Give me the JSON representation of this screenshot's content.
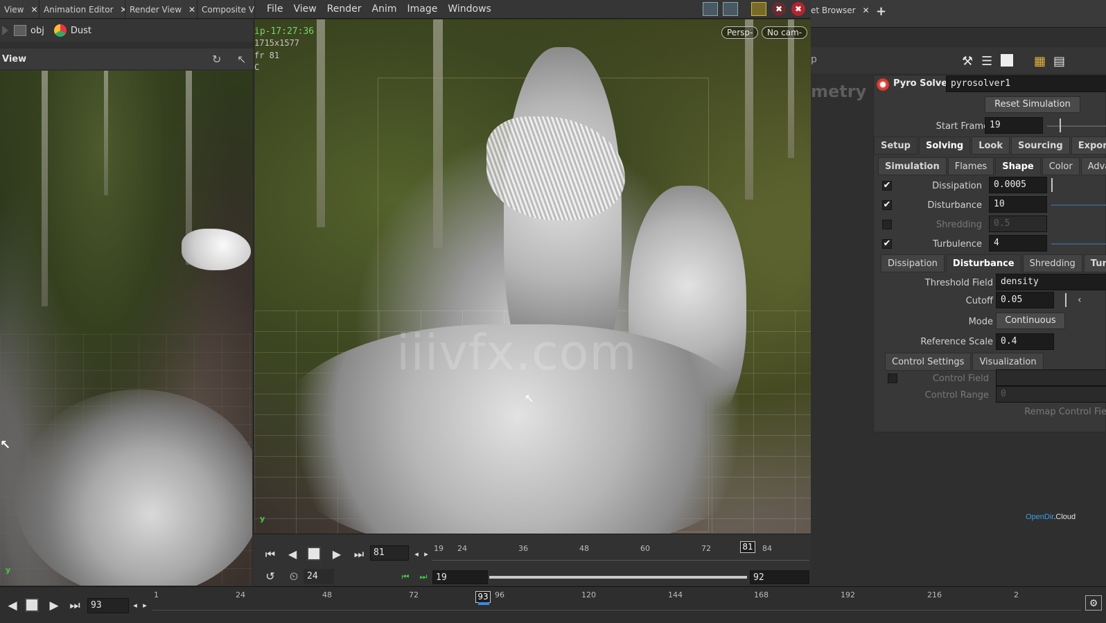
{
  "left_tabs": [
    {
      "label": "View",
      "close": "✕"
    },
    {
      "label": "Animation Editor",
      "close": "✕"
    },
    {
      "label": "Render View",
      "close": "✕"
    },
    {
      "label": "Composite Vi"
    }
  ],
  "left_path": {
    "obj": "obj",
    "node": "Dust"
  },
  "left_view_label": "View",
  "menu": [
    "File",
    "View",
    "Render",
    "Anim",
    "Image",
    "Windows"
  ],
  "viewport": {
    "title": "ip-17:27:36",
    "resolution": "1715x1577",
    "frame": "fr 81",
    "channel": "C",
    "persp_button": "Persp-",
    "cam_button": "No cam-",
    "watermark": "iiivfx.com"
  },
  "playbar": {
    "current_frame": "81",
    "fps": "24",
    "range_start": "19",
    "range_end": "92",
    "ruler_ticks": [
      "19",
      "24",
      "36",
      "48",
      "60",
      "72",
      "84"
    ],
    "marker_frame": "81"
  },
  "timeline": {
    "current_frame": "93",
    "ruler_ticks": [
      "1",
      "24",
      "48",
      "72",
      "96",
      "120",
      "144",
      "168",
      "192",
      "216",
      "2"
    ],
    "marker_frame": "93"
  },
  "right_tabs": [
    {
      "label": "et Browser",
      "close": "✕"
    },
    {
      "label": "+"
    }
  ],
  "right_path_letter": "p",
  "geometry_ghost": "metry",
  "node": {
    "type": "Pyro Solver",
    "name": "pyrosolver1"
  },
  "reset_button": "Reset Simulation",
  "start_frame": {
    "label": "Start Frame",
    "value": "19"
  },
  "main_tabs": [
    "Setup",
    "Solving",
    "Look",
    "Sourcing",
    "Export"
  ],
  "main_tab_active": "Solving",
  "sub_tabs": [
    "Simulation",
    "Flames",
    "Shape",
    "Color",
    "Advanc"
  ],
  "sub_tab_active": "Shape",
  "shape_params": [
    {
      "label": "Dissipation",
      "value": "0.0005",
      "checked": true,
      "enabled": true
    },
    {
      "label": "Disturbance",
      "value": "10",
      "checked": true,
      "enabled": true
    },
    {
      "label": "Shredding",
      "value": "0.5",
      "checked": false,
      "enabled": false
    },
    {
      "label": "Turbulence",
      "value": "4",
      "checked": true,
      "enabled": true
    }
  ],
  "shape_tabs": [
    "Dissipation",
    "Disturbance",
    "Shredding",
    "Turbu"
  ],
  "shape_tab_active": "Disturbance",
  "disturbance": {
    "threshold_field": {
      "label": "Threshold Field",
      "value": "density"
    },
    "cutoff": {
      "label": "Cutoff",
      "value": "0.05"
    },
    "mode": {
      "label": "Mode",
      "value": "Continuous"
    },
    "reference_scale": {
      "label": "Reference Scale",
      "value": "0.4"
    }
  },
  "control_tabs": [
    "Control Settings",
    "Visualization"
  ],
  "control": {
    "control_field": {
      "label": "Control Field"
    },
    "control_range": {
      "label": "Control Range",
      "value": "0"
    },
    "remap": {
      "label": "Remap Control Fie"
    }
  },
  "branding": {
    "part1": "OpenDir",
    "part2": ".Cloud"
  }
}
